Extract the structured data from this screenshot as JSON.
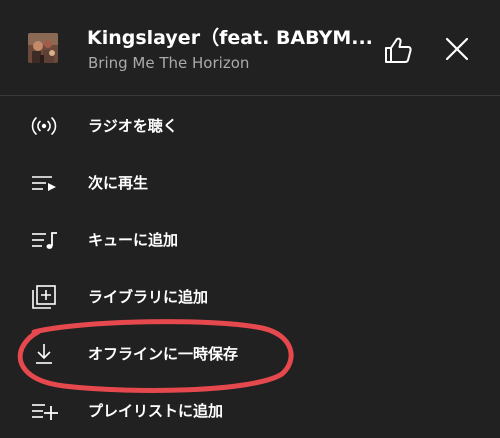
{
  "track": {
    "title": "Kingslayer（feat. BABYM...",
    "artist": "Bring Me The Horizon",
    "album_art_icon": "album-art-thumbnail"
  },
  "header_actions": {
    "like_icon": "thumbs-up-icon",
    "close_icon": "close-icon"
  },
  "menu": {
    "items": [
      {
        "id": "radio",
        "label": "ラジオを聴く",
        "icon": "radio-broadcast-icon"
      },
      {
        "id": "play-next",
        "label": "次に再生",
        "icon": "play-next-icon"
      },
      {
        "id": "add-to-queue",
        "label": "キューに追加",
        "icon": "add-to-queue-icon"
      },
      {
        "id": "add-to-library",
        "label": "ライブラリに追加",
        "icon": "library-add-icon"
      },
      {
        "id": "download",
        "label": "オフラインに一時保存",
        "icon": "download-icon"
      },
      {
        "id": "add-to-playlist",
        "label": "プレイリストに追加",
        "icon": "playlist-add-icon"
      }
    ]
  },
  "colors": {
    "background": "#212121",
    "primary_text": "#ffffff",
    "secondary_text": "#aaaaaa",
    "divider": "#3a3a3a",
    "highlight": "#e5484d"
  }
}
